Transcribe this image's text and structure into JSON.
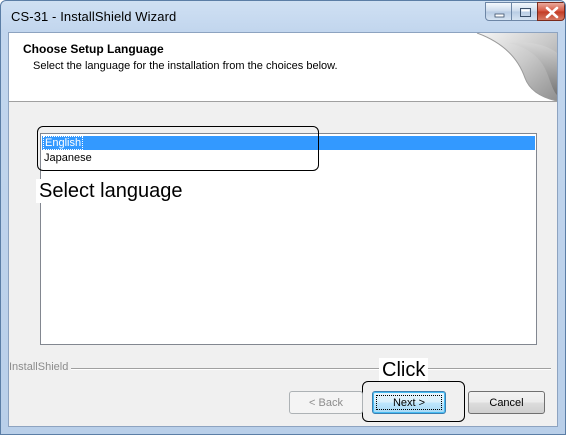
{
  "window": {
    "title": "CS-31 - InstallShield Wizard"
  },
  "header": {
    "title": "Choose Setup Language",
    "subtitle": "Select the language for the installation from the choices below."
  },
  "language_list": {
    "items": [
      {
        "label": "English",
        "selected": true
      },
      {
        "label": "Japanese",
        "selected": false
      }
    ]
  },
  "annotations": {
    "select_language": "Select language",
    "click": "Click"
  },
  "footer": {
    "brand": "InstallShield"
  },
  "buttons": {
    "back": "< Back",
    "next": "Next >",
    "cancel": "Cancel"
  },
  "colors": {
    "selection": "#3399ff",
    "close_button": "#c23b24"
  }
}
